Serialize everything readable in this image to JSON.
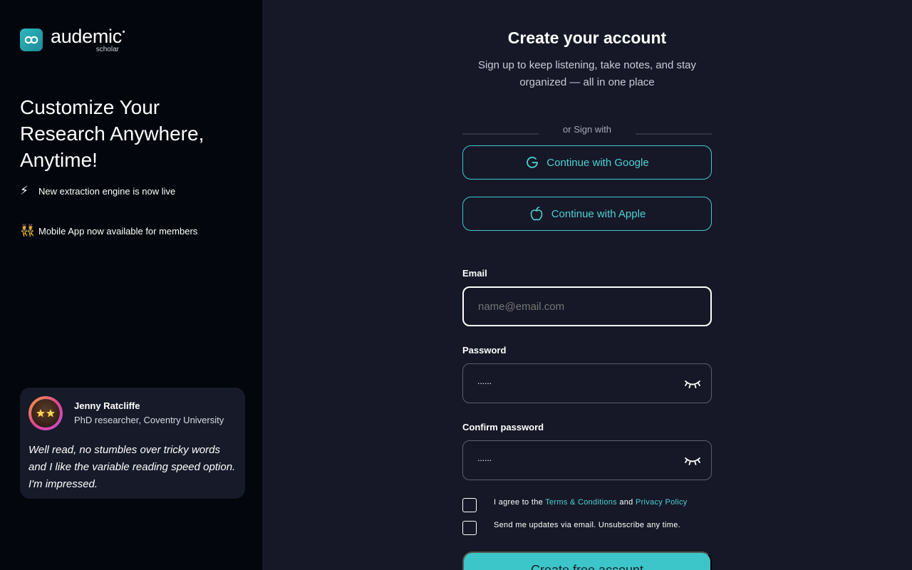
{
  "brand": {
    "name": "audemic",
    "sub": "scholar",
    "accent": "#3cc6c9"
  },
  "left": {
    "headline": "Customize Your Research Anywhere, Anytime!",
    "news": [
      {
        "icon": "lightning-icon",
        "emoji": "⚡",
        "text": "New extraction engine is now live"
      },
      {
        "icon": "dancers-icon",
        "emoji": "👯",
        "text": "Mobile App now available for members"
      }
    ],
    "testimonial": {
      "name": "Jenny Ratcliffe",
      "role": "PhD researcher, Coventry University",
      "quote": "Well read, no stumbles over tricky words and I like the variable reading speed option. I'm impressed."
    }
  },
  "form": {
    "title": "Create your account",
    "subtitle": "Sign up to keep listening, take notes, and stay organized — all in one place",
    "divider": "or Sign with",
    "google": "Continue with Google",
    "apple": "Continue with Apple",
    "email_label": "Email",
    "email_placeholder": "name@email.com",
    "password_label": "Password",
    "password_value": "......",
    "confirm_label": "Confirm password",
    "confirm_value": "......",
    "agree_prefix": "I agree to the ",
    "terms": "Terms & Conditions",
    "agree_and": " and ",
    "privacy": "Privacy Policy",
    "updates": "Send me updates via email. Unsubscribe any time.",
    "submit": "Create free account"
  }
}
